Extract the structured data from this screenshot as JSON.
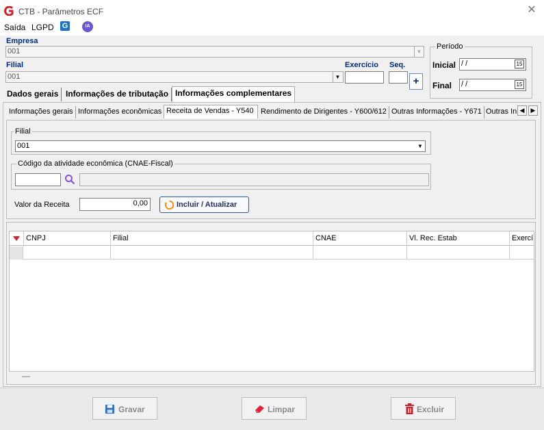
{
  "window": {
    "title": "CTB - Parâmetros ECF",
    "close_glyph": "✕",
    "app_icon": "ctb-logo-icon"
  },
  "menubar": {
    "items": [
      "Saída",
      "LGPD"
    ],
    "g_badge": "G",
    "ia_badge": "IA"
  },
  "empresa": {
    "label": "Empresa",
    "value": "001"
  },
  "filial": {
    "label": "Filial",
    "value": "001"
  },
  "exercicio": {
    "label": "Exercício",
    "value": ""
  },
  "seq": {
    "label": "Seq.",
    "value": ""
  },
  "add_button": "+",
  "periodo": {
    "label": "Período",
    "inicial_label": "Inicial",
    "inicial_value": " / /",
    "final_label": "Final",
    "final_value": " / /",
    "calendar_glyph": "15"
  },
  "main_tabs": [
    "Dados gerais",
    "Informações de tributação",
    "Informações complementares"
  ],
  "sub_tabs": [
    "Informações gerais",
    "Informações econômicas",
    "Receita de Vendas - Y540",
    "Rendimento de Dirigentes - Y600/612",
    "Outras Informações - Y671",
    "Outras In"
  ],
  "form": {
    "filial_group": "Filial",
    "filial_value": "001",
    "cnae_group": "Código da atividade econômica (CNAE-Fiscal)",
    "cnae_code": "",
    "cnae_desc": "",
    "valor_label": "Valor da Receita",
    "valor_value": "0,00",
    "incluir_label": "Incluir / Atualizar"
  },
  "grid": {
    "columns": [
      "CNPJ",
      "Filial",
      "CNAE",
      "Vl. Rec. Estab",
      "Exercí"
    ],
    "footer": "—"
  },
  "buttons": {
    "gravar": "Gravar",
    "limpar": "Limpar",
    "excluir": "Excluir"
  },
  "colors": {
    "accent": "#002b80",
    "brand": "#d0202a",
    "ia": "#6a57d6",
    "g_badge": "#1a73c9"
  }
}
